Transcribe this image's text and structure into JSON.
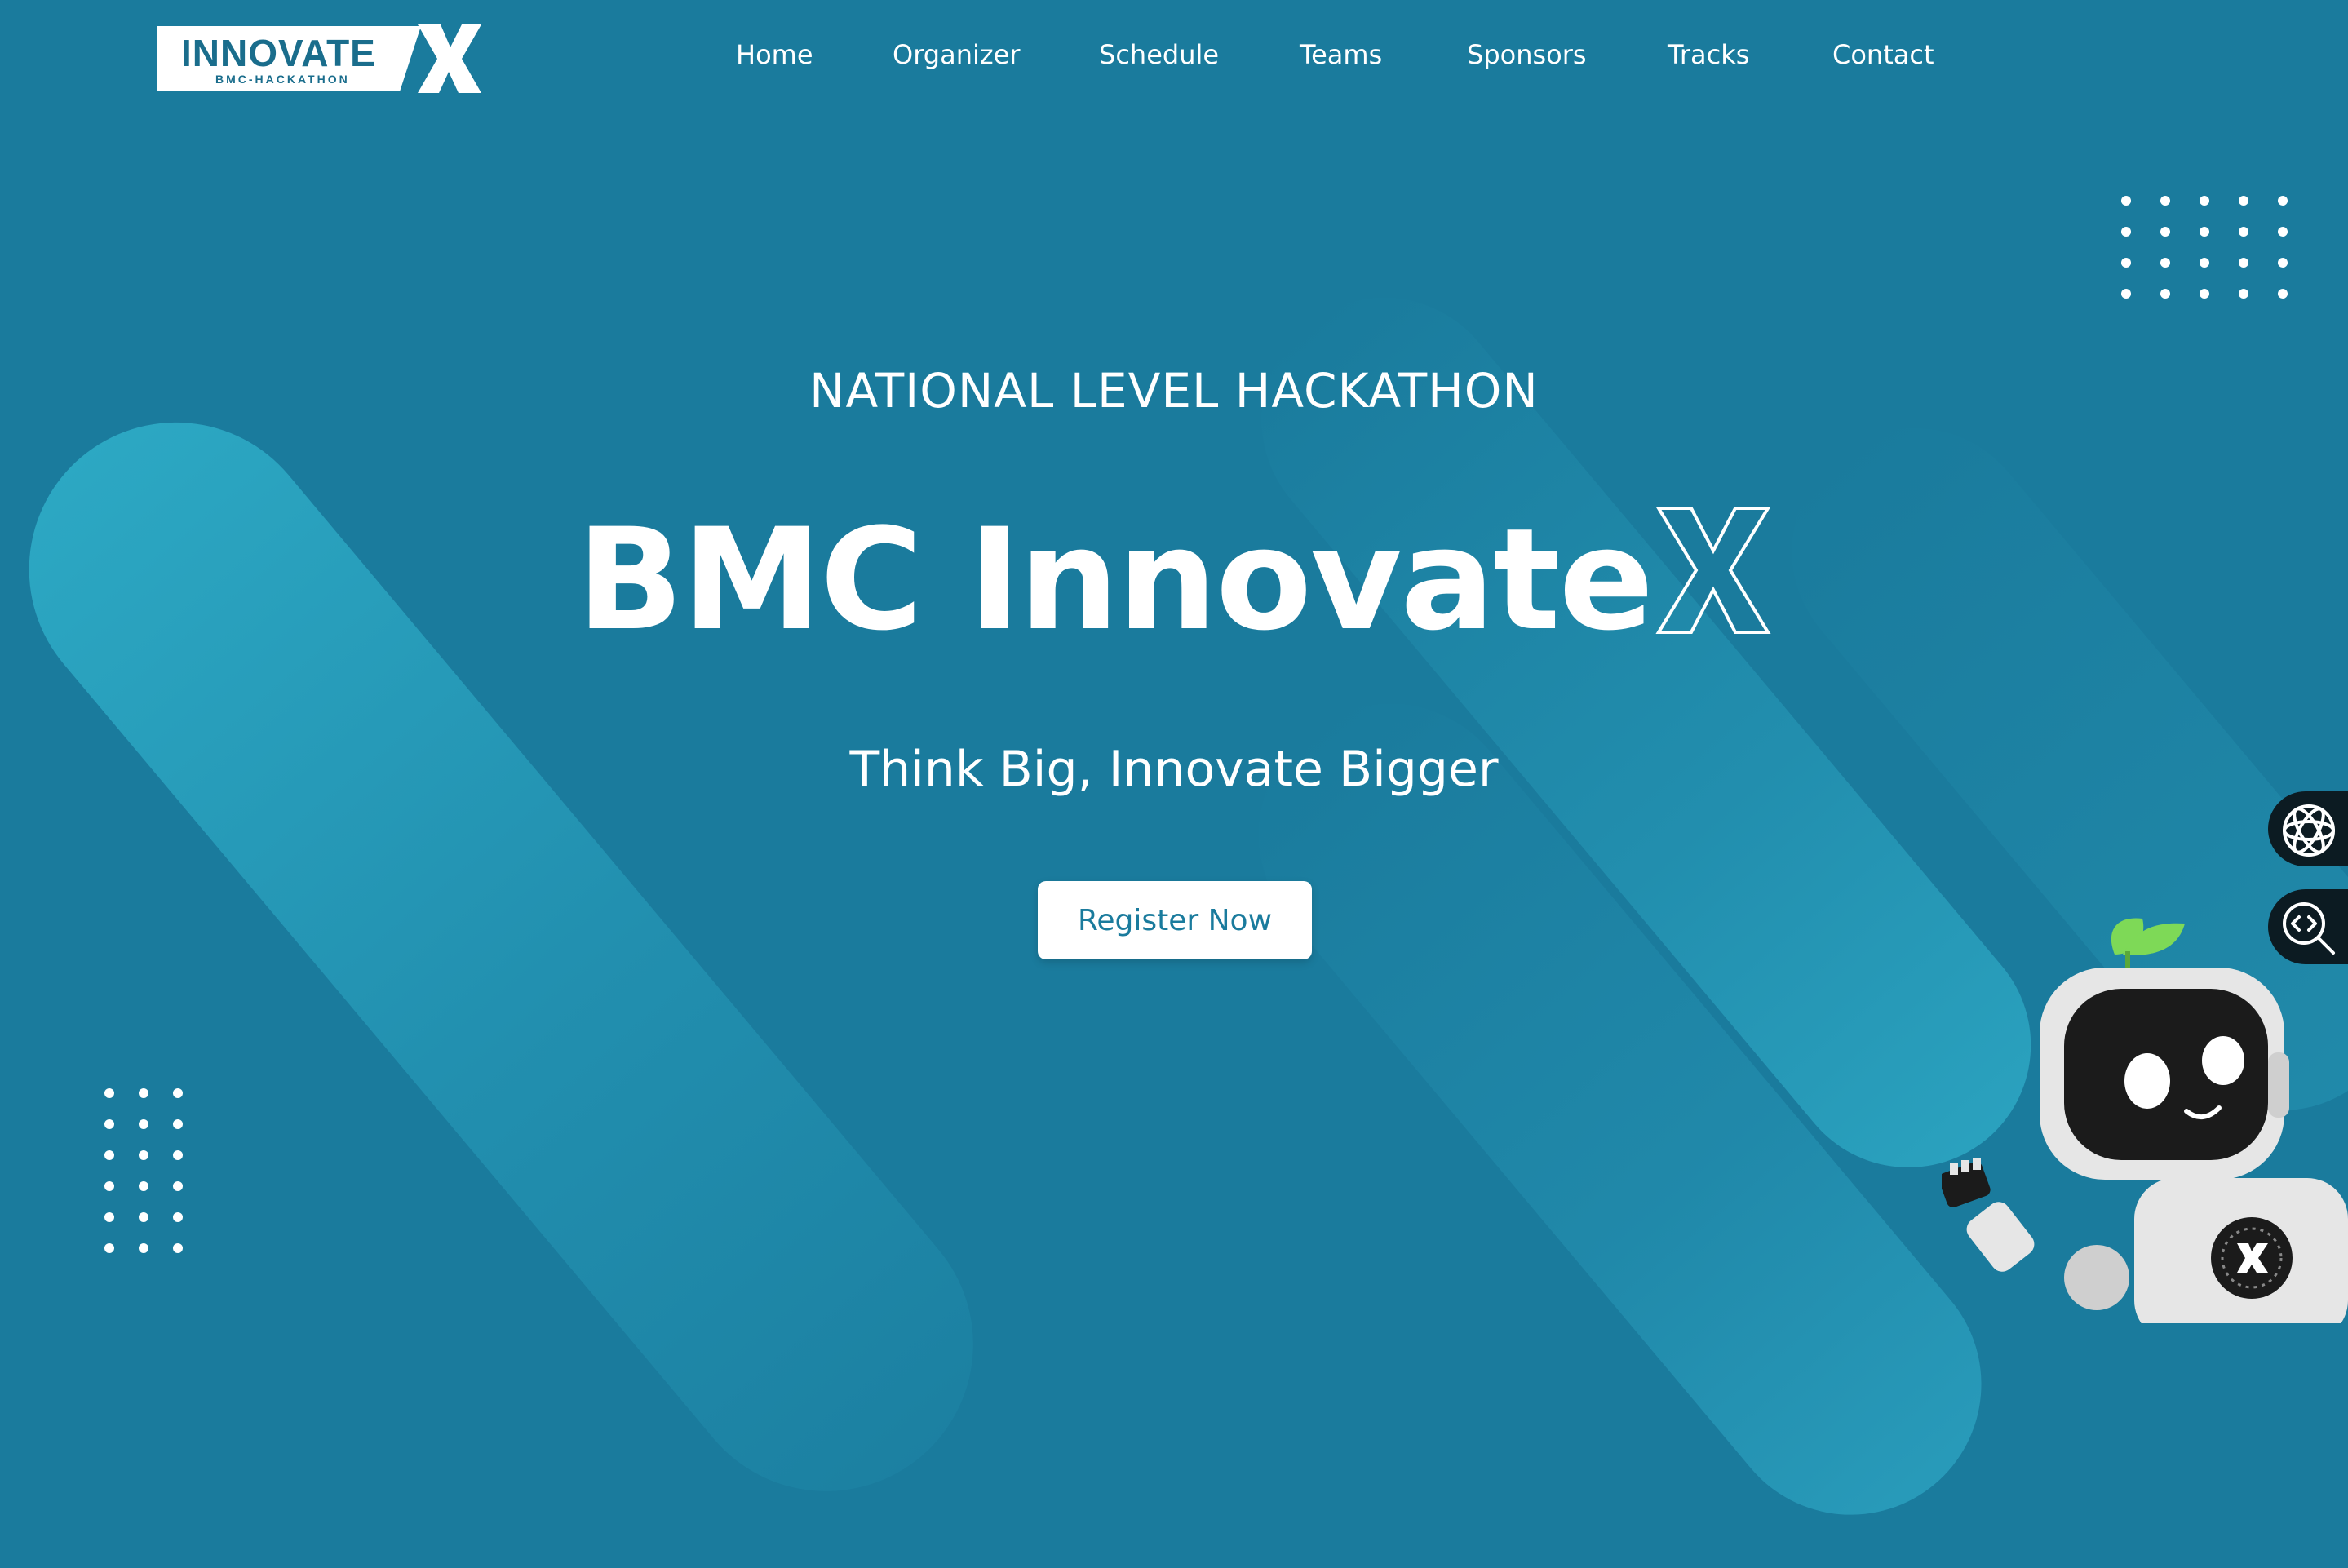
{
  "brand": {
    "logo_word": "INNOVATE",
    "logo_sub": "BMC-HACKATHON",
    "logo_letter": "X"
  },
  "nav": {
    "items": [
      {
        "label": "Home"
      },
      {
        "label": "Organizer"
      },
      {
        "label": "Schedule"
      },
      {
        "label": "Teams"
      },
      {
        "label": "Sponsors"
      },
      {
        "label": "Tracks"
      },
      {
        "label": "Contact"
      }
    ]
  },
  "hero": {
    "eyebrow": "NATIONAL LEVEL HACKATHON",
    "title": "BMC Innovate",
    "title_outline_letter": "X",
    "tagline": "Think Big, Innovate Bigger",
    "cta_label": "Register Now"
  },
  "widgets": {
    "top_icon": "ai-assistant-icon",
    "bottom_icon": "code-search-icon",
    "mascot": "robot-mascot-icon"
  },
  "colors": {
    "background": "#1a7b9d",
    "stripe": "#2aa3c0",
    "text": "#ffffff",
    "button_text": "#1a7b9d",
    "widget_bg": "#0c1b22",
    "leaf": "#7ed957"
  }
}
